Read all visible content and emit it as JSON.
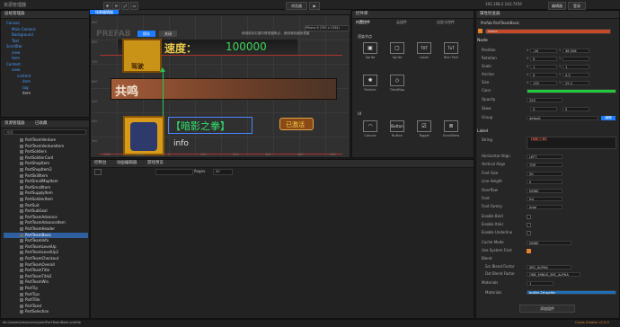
{
  "menubar": {
    "title": "资源管理器",
    "play_mode": "浏览器",
    "ip": "192.168.2.142:7456",
    "edit_label": "编辑器",
    "login_label": "登录"
  },
  "hierarchy": {
    "title": "层级管理器",
    "rows": [
      {
        "label": "Canvas",
        "color": "blue",
        "indent": 0
      },
      {
        "label": "Main Camera",
        "color": "blue",
        "indent": 1
      },
      {
        "label": "Background",
        "color": "blue",
        "indent": 1
      },
      {
        "label": "Text",
        "color": "blue",
        "indent": 1
      },
      {
        "label": "ScrollBar",
        "color": "blue",
        "indent": 0
      },
      {
        "label": "view",
        "color": "blue",
        "indent": 1
      },
      {
        "label": "item",
        "color": "blue",
        "indent": 1
      },
      {
        "label": "Content",
        "color": "blue",
        "indent": 0
      },
      {
        "label": "view",
        "color": "blue",
        "indent": 1
      },
      {
        "label": "content",
        "color": "blue",
        "indent": 2
      },
      {
        "label": "item",
        "color": "blue",
        "indent": 3
      },
      {
        "label": "tag",
        "color": "blue",
        "indent": 3
      },
      {
        "label": "item",
        "color": "white",
        "indent": 3
      }
    ]
  },
  "assets": {
    "title": "资源管理器",
    "tab2": "已收藏",
    "search_placeholder": "搜索",
    "rows": [
      "PartTeamVenture",
      "PartTeamVentureItem",
      "PartSoldiers",
      "PartSoldierCard",
      "PartShopItem",
      "PartShopItem2",
      "PartSkillItem",
      "PartSmallMapItem",
      "PartSmallItem",
      "PartSupplyItem",
      "PartSoldierItem",
      "PartSuit",
      "PartSubGoal",
      "PartTeamAdvance",
      "PartTeamAdvanceItem",
      "PartTeamHeader",
      "PartTeamBasic",
      "PartTeamInfo",
      "PartTeamLevelUp",
      "PartTeamLevelUp2",
      "PartTeamCheckout",
      "PartTeamOverall",
      "PartTeamTitle",
      "PartTeamTitle2",
      "PartTeamWin",
      "PartTip",
      "PartTips",
      "PartTitle",
      "PartToast",
      "PartSelection"
    ],
    "selected_index": 16,
    "status_path": "db://assets/resources/part/PartTeamBasic.prefab"
  },
  "scene": {
    "tab": "场景编辑器",
    "hint": "使用鼠标右键平移视窗焦点，使用滚轮缩放视窗",
    "resolution": "iPhone 6 (750 x 1334)",
    "btn_save": "保存",
    "btn_close": "关闭",
    "watermark": "PREFAB",
    "speed_label": "速度：",
    "speed_value": "100000",
    "badge_text": "驾驶",
    "banner2": "共鸣",
    "skill_name": "【暗影之拳】",
    "activated_label": "已激活",
    "info_label": "info",
    "ruler_left": [
      "900",
      "800",
      "700",
      "600",
      "500",
      "400",
      "300"
    ],
    "ruler_bottom": [
      "-200",
      "-100",
      "0",
      "100",
      "200",
      "300",
      "400",
      "500"
    ]
  },
  "widgets": {
    "title": "控件库",
    "tabs": [
      "内置控件",
      "云组件",
      "自定义控件"
    ],
    "section1": "渲染节点",
    "items1": [
      {
        "label": "Sprite",
        "glyph": "▣"
      },
      {
        "label": "Sprite",
        "glyph": "▢"
      },
      {
        "label": "Label",
        "glyph": "TXT"
      },
      {
        "label": "Rich Text",
        "glyph": "TxT"
      },
      {
        "label": "Particle",
        "glyph": "✺"
      },
      {
        "label": "TiledMap",
        "glyph": "◇"
      }
    ],
    "section2": "UI",
    "items2": [
      {
        "label": "Canvas",
        "glyph": "◠"
      },
      {
        "label": "Button",
        "glyph": "Button"
      },
      {
        "label": "Toggle",
        "glyph": "☑"
      },
      {
        "label": "ScrollView",
        "glyph": "≣"
      }
    ]
  },
  "console": {
    "tabs": [
      "控制台",
      "动画编辑器",
      "游戏预览"
    ],
    "filter_label": "Regex",
    "level": "All"
  },
  "inspector": {
    "title": "属性检查器",
    "prefab_row": "Prefab  PartTeamBasic",
    "node_name": "Name",
    "node_section": "Node",
    "props": [
      {
        "label": "Position",
        "x": "-16",
        "y": "38.556"
      },
      {
        "label": "Rotation",
        "x": "0",
        "y": ""
      },
      {
        "label": "Scale",
        "x": "1",
        "y": "1"
      },
      {
        "label": "Anchor",
        "x": "0",
        "y": "0.5"
      },
      {
        "label": "Size",
        "x": "135",
        "y": "25.2"
      }
    ],
    "color_label": "Color",
    "color_value": "#22c93a",
    "opacity_label": "Opacity",
    "opacity_value": "255",
    "skew_label": "Skew",
    "skew_x": "0",
    "skew_y": "0",
    "group_label": "Group",
    "group_value": "default",
    "group_btn": "编辑",
    "label_section": "Label",
    "string_label": "String",
    "string_value": "【暗影之拳】",
    "label_props": [
      {
        "label": "Horizontal Align",
        "value": "LEFT"
      },
      {
        "label": "Vertical Align",
        "value": "TOP"
      },
      {
        "label": "Font Size",
        "value": "20"
      },
      {
        "label": "Line Height",
        "value": "0"
      },
      {
        "label": "Overflow",
        "value": "NONE"
      },
      {
        "label": "Font",
        "value": "fnt"
      },
      {
        "label": "Font Family",
        "value": "Arial"
      }
    ],
    "checks": [
      {
        "label": "Enable Bold",
        "on": false
      },
      {
        "label": "Enable Italic",
        "on": false
      },
      {
        "label": "Enable Underline",
        "on": false
      }
    ],
    "cache_mode_label": "Cache Mode",
    "cache_mode_value": "NONE",
    "system_font_label": "Use System Font",
    "blend_label": "Blend",
    "src_label": "Src Blend Factor",
    "src_value": "SRC_ALPHA",
    "dst_label": "Dst Blend Factor",
    "dst_value": "ONE_MINUS_SRC_ALPHA",
    "materials_label": "Materials",
    "materials_count": "1",
    "materials_item_label": "Materials",
    "materials_item_value": "builtin-2d-sprite",
    "add_component": "添加组件"
  },
  "footer": {
    "version": "Cocos Creator v2.4.3"
  }
}
